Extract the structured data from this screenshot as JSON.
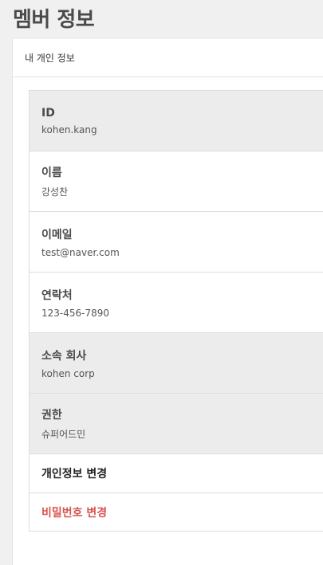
{
  "page": {
    "title": "멤버 정보"
  },
  "panel": {
    "header": "내 개인 정보"
  },
  "info": [
    {
      "label": "ID",
      "value": "kohen.kang",
      "shaded": true
    },
    {
      "label": "이름",
      "value": "강성찬",
      "shaded": false
    },
    {
      "label": "이메일",
      "value": "test@naver.com",
      "shaded": false
    },
    {
      "label": "연락처",
      "value": "123-456-7890",
      "shaded": false
    },
    {
      "label": "소속 회사",
      "value": "kohen corp",
      "shaded": true
    },
    {
      "label": "권한",
      "value": "슈퍼어드민",
      "shaded": true
    }
  ],
  "actions": {
    "edit_info": "개인정보 변경",
    "change_password": "비밀번호 변경"
  },
  "colors": {
    "danger": "#d9534f",
    "shaded_row": "#ececec"
  }
}
